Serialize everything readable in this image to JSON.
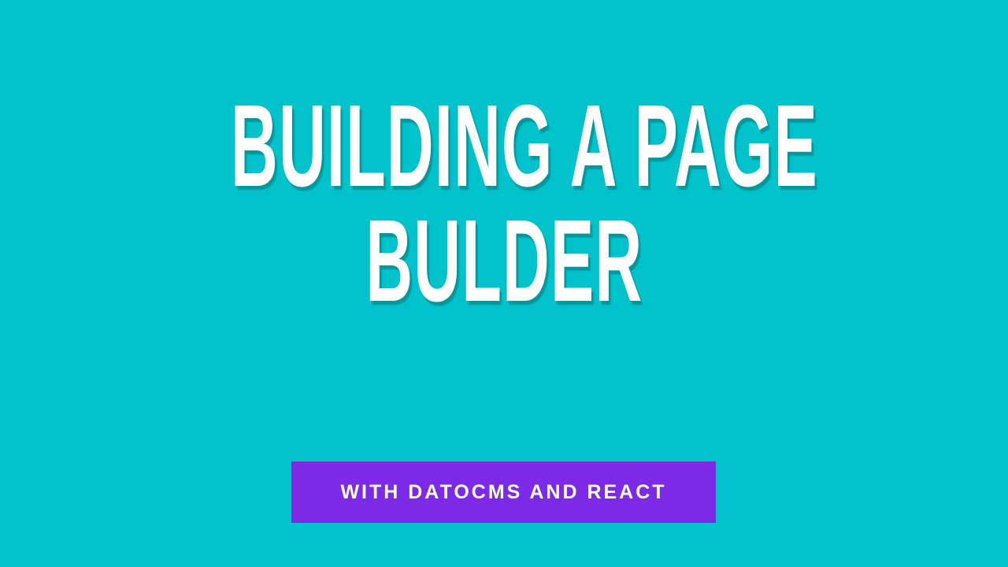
{
  "colors": {
    "background": "#00c2cb",
    "title_text": "#ffffff",
    "subtitle_box": "#7d2ae8",
    "subtitle_text": "#ffffff"
  },
  "title": {
    "line1": "BUILDING A PAGE",
    "line2": "BULDER"
  },
  "subtitle": {
    "label": "WITH DATOCMS AND REACT"
  }
}
